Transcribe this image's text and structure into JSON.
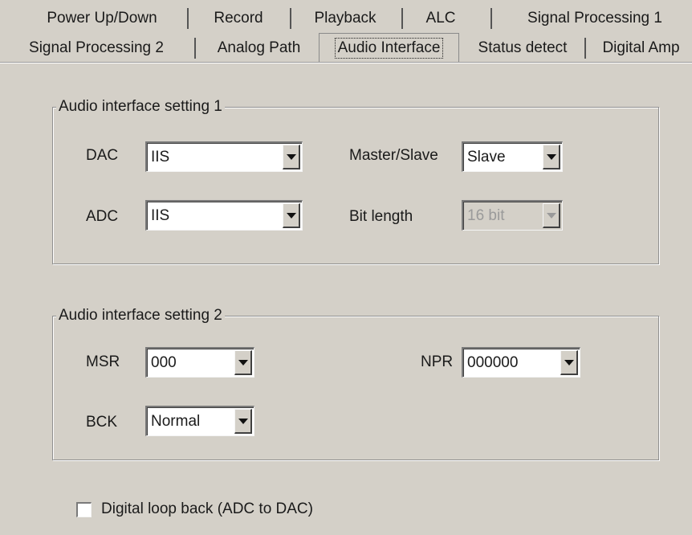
{
  "tabs": {
    "row1": [
      "Power Up/Down",
      "Record",
      "Playback",
      "ALC",
      "Signal Processing 1"
    ],
    "row2": [
      "Signal Processing 2",
      "Analog Path",
      "Audio Interface",
      "Status detect",
      "Digital Amp"
    ],
    "active": "Audio Interface"
  },
  "group1": {
    "title": "Audio interface setting 1",
    "dac_label": "DAC",
    "dac_value": "IIS",
    "adc_label": "ADC",
    "adc_value": "IIS",
    "master_slave_label": "Master/Slave",
    "master_slave_value": "Slave",
    "bit_length_label": "Bit length",
    "bit_length_value": "16 bit"
  },
  "group2": {
    "title": "Audio interface setting 2",
    "msr_label": "MSR",
    "msr_value": "000",
    "npr_label": "NPR",
    "npr_value": "000000",
    "bck_label": "BCK",
    "bck_value": "Normal"
  },
  "loopback": {
    "label": "Digital loop back (ADC to DAC)",
    "checked": false
  },
  "colors": {
    "window_bg": "#d4d0c8",
    "disabled_text": "#9a9a9a"
  }
}
